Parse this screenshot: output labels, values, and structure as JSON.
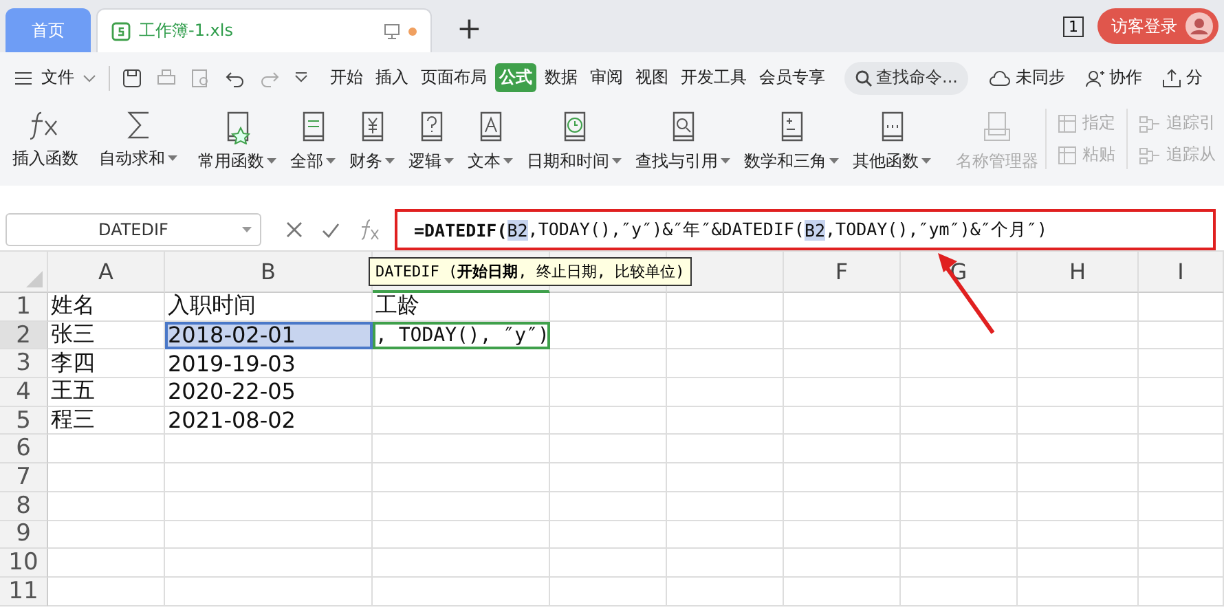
{
  "tabs": [
    {
      "label": "首页",
      "kind": "home",
      "selected": false
    },
    {
      "label": "工作簿-1.xls",
      "kind": "doc",
      "selected": true
    }
  ],
  "new_tab": "+",
  "window_count": "1",
  "login_button": "访客登录",
  "menu": {
    "file": "文件",
    "items": [
      {
        "label": "开始",
        "selected": false
      },
      {
        "label": "插入",
        "selected": false
      },
      {
        "label": "页面布局",
        "selected": false
      },
      {
        "label": "公式",
        "selected": true
      },
      {
        "label": "数据",
        "selected": false
      },
      {
        "label": "审阅",
        "selected": false
      },
      {
        "label": "视图",
        "selected": false
      },
      {
        "label": "开发工具",
        "selected": false
      },
      {
        "label": "会员专享",
        "selected": false
      }
    ],
    "search": {
      "placeholder": "查找命令..."
    },
    "right": [
      {
        "label": "未同步",
        "kind": "cloud"
      },
      {
        "label": "协作",
        "kind": "user"
      },
      {
        "label": "分",
        "kind": "share"
      }
    ]
  },
  "ribbon": [
    {
      "label": "插入函数",
      "kind": "fx",
      "dropdown": false
    },
    {
      "label": "自动求和",
      "kind": "sum",
      "dropdown": true
    },
    {
      "label": "常用函数",
      "kind": "star",
      "dropdown": true
    },
    {
      "label": "全部",
      "kind": "fxbook",
      "dropdown": true
    },
    {
      "label": "财务",
      "kind": "yen",
      "dropdown": true
    },
    {
      "label": "逻辑",
      "kind": "question",
      "dropdown": true
    },
    {
      "label": "文本",
      "kind": "letter",
      "dropdown": true
    },
    {
      "label": "日期和时间",
      "kind": "clock",
      "dropdown": true
    },
    {
      "label": "查找与引用",
      "kind": "search",
      "dropdown": true
    },
    {
      "label": "数学和三角",
      "kind": "math",
      "dropdown": true
    },
    {
      "label": "其他函数",
      "kind": "dots",
      "dropdown": true
    }
  ],
  "ribbon_disabled": {
    "large": {
      "label": "名称管理器",
      "disabled": true
    },
    "small": [
      {
        "label": "指定",
        "disabled": true
      },
      {
        "label": "粘贴",
        "disabled": true
      }
    ],
    "trace": [
      {
        "label": "追踪引",
        "disabled": true
      },
      {
        "label": "追踪从",
        "disabled": true
      }
    ]
  },
  "name_box": "DATEDIF",
  "formula": [
    {
      "text": "=DATEDIF(",
      "bold": true,
      "highlighted": false
    },
    {
      "text": "B2",
      "bold": false,
      "highlighted": true
    },
    {
      "text": ",TODAY(),″y″)&″年″&DATEDIF(",
      "bold": false,
      "highlighted": false
    },
    {
      "text": "B2",
      "bold": false,
      "highlighted": true
    },
    {
      "text": ",TODAY(),″ym″)&″个月″)",
      "bold": false,
      "highlighted": false
    }
  ],
  "tooltip": "DATEDIF (**开始日期**, 终止日期, 比较单位)",
  "columns": [
    {
      "label": "A",
      "selected": false
    },
    {
      "label": "B",
      "selected": false
    },
    {
      "selected": true
    },
    {
      "selected": false
    },
    {
      "selected": false
    },
    {
      "label": "F",
      "selected": false
    },
    {
      "label": "G",
      "selected": false
    },
    {
      "label": "H",
      "selected": false
    },
    {
      "label": "I",
      "selected": false
    }
  ],
  "rows": [
    {
      "label": "1",
      "selected": false,
      "cells": [
        {
          "text": "姓名",
          "selected": false,
          "editing": false
        },
        {
          "text": "入职时间",
          "selected": false,
          "editing": false
        },
        {
          "text": "工龄",
          "selected": false,
          "editing": false
        }
      ]
    },
    {
      "label": "2",
      "selected": true,
      "cells": [
        {
          "text": "张三",
          "selected": false,
          "editing": false
        },
        {
          "text": "2018-02-01",
          "selected": true,
          "editing": false
        },
        {
          "text": ", TODAY(), ″y″)",
          "selected": false,
          "editing": true
        }
      ]
    },
    {
      "label": "3",
      "selected": false,
      "cells": [
        {
          "text": "李四",
          "selected": false,
          "editing": false
        },
        {
          "text": "2019-19-03",
          "selected": false,
          "editing": false
        }
      ]
    },
    {
      "label": "4",
      "selected": false,
      "cells": [
        {
          "text": "王五",
          "selected": false,
          "editing": false
        },
        {
          "text": "2020-22-05",
          "selected": false,
          "editing": false
        }
      ]
    },
    {
      "label": "5",
      "selected": false,
      "cells": [
        {
          "text": "程三",
          "selected": false,
          "editing": false
        },
        {
          "text": "2021-08-02",
          "selected": false,
          "editing": false
        }
      ]
    },
    {
      "label": "6",
      "selected": false,
      "cells": []
    },
    {
      "label": "7",
      "selected": false,
      "cells": []
    },
    {
      "label": "8",
      "selected": false,
      "cells": []
    },
    {
      "label": "9",
      "selected": false,
      "cells": []
    },
    {
      "label": "10",
      "selected": false,
      "cells": []
    },
    {
      "label": "11",
      "selected": false,
      "cells": []
    }
  ]
}
